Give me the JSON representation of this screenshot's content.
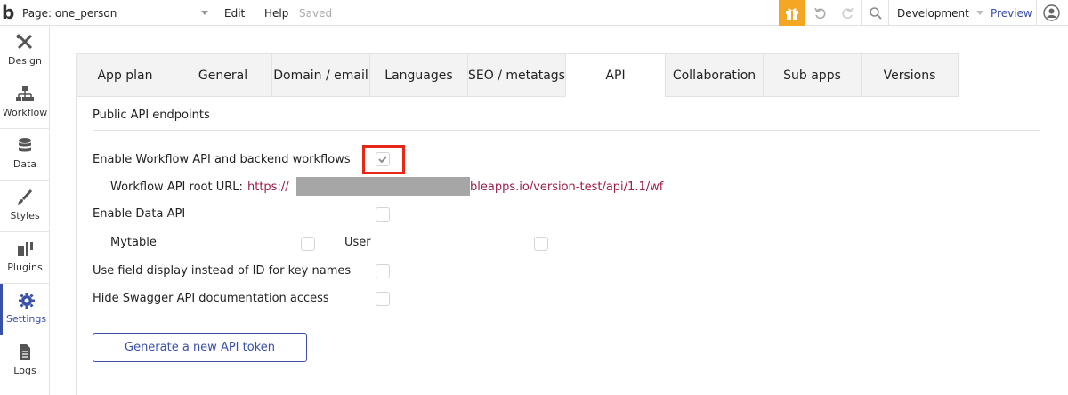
{
  "topbar": {
    "logo": "b",
    "page_select": "Page: one_person",
    "menu": {
      "edit": "Edit",
      "help": "Help",
      "saved": "Saved"
    },
    "environment": "Development",
    "preview": "Preview",
    "accent_color": "#f5a623"
  },
  "sidebar": {
    "items": [
      {
        "label": "Design",
        "icon": "design-icon"
      },
      {
        "label": "Workflow",
        "icon": "workflow-icon"
      },
      {
        "label": "Data",
        "icon": "database-icon"
      },
      {
        "label": "Styles",
        "icon": "brush-icon"
      },
      {
        "label": "Plugins",
        "icon": "plug-icon"
      },
      {
        "label": "Settings",
        "icon": "gear-icon",
        "active": true
      },
      {
        "label": "Logs",
        "icon": "document-icon"
      }
    ]
  },
  "tabs": [
    {
      "label": "App plan"
    },
    {
      "label": "General"
    },
    {
      "label": "Domain / email"
    },
    {
      "label": "Languages"
    },
    {
      "label": "SEO / metatags"
    },
    {
      "label": "API",
      "active": true
    },
    {
      "label": "Collaboration"
    },
    {
      "label": "Sub apps"
    },
    {
      "label": "Versions"
    }
  ],
  "content": {
    "section_title": "Public API endpoints",
    "enable_workflow_label": "Enable Workflow API and backend workflows",
    "enable_workflow_checked": true,
    "workflow_url_label": "Workflow API root URL:",
    "workflow_url_start": "https://",
    "workflow_url_end": "bleapps.io/version-test/api/1.1/wf",
    "enable_data_label": "Enable Data API",
    "enable_data_checked": false,
    "data_types": [
      {
        "label": "Mytable",
        "checked": false
      },
      {
        "label": "User",
        "checked": false
      }
    ],
    "field_display_label": "Use field display instead of ID for key names",
    "field_display_checked": false,
    "hide_swagger_label": "Hide Swagger API documentation access",
    "hide_swagger_checked": false,
    "generate_button": "Generate a new API token",
    "link_color": "#9b1d4a",
    "primary_color": "#3a4fa8",
    "highlight_color": "#e8271b"
  }
}
